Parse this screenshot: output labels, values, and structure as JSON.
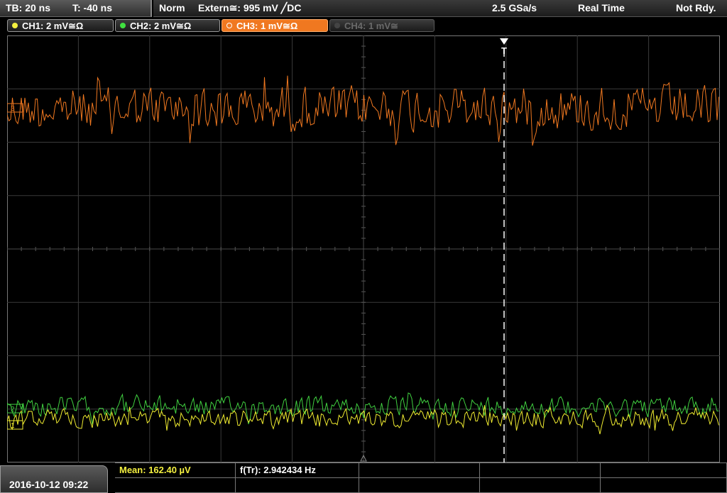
{
  "header": {
    "timebase": "TB: 20 ns",
    "trigger_offset": "T: -40 ns",
    "trigger_mode": "Norm",
    "trigger_source": "Extern≅: 995 mV ╱DC",
    "sample_rate": "2.5 GSa/s",
    "acq_mode": "Real Time",
    "status": "Not Rdy."
  },
  "channels": [
    {
      "label": "CH1: 2 mV≅Ω",
      "color": "#f4f040",
      "state": "on"
    },
    {
      "label": "CH2: 2 mV≅Ω",
      "color": "#40e040",
      "state": "on"
    },
    {
      "label": "CH3: 1 mV≅Ω",
      "color": "#f07820",
      "state": "active"
    },
    {
      "label": "CH4: 1 mV≅",
      "color": "#5a5a5a",
      "state": "off"
    }
  ],
  "markers": {
    "trigger_marker": "T",
    "ch3_marker": "3",
    "ch2_marker": "2",
    "ch1_marker": "1"
  },
  "footer": {
    "datetime": "2016-10-12 09:22",
    "measurement_1": "Mean: 162.40 µV",
    "measurement_2": "f(Tr): 2.942434 Hz",
    "measurement_1_color": "#f4f040"
  }
}
